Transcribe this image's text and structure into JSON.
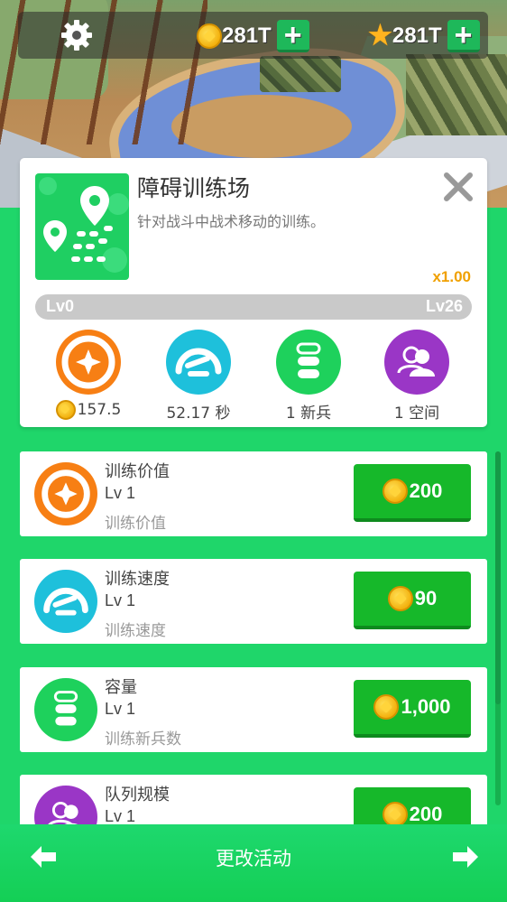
{
  "topbar": {
    "coins": "281T",
    "stars": "281T",
    "plus": "+"
  },
  "facility": {
    "title": "障碍训练场",
    "description": "针对战斗中战术移动的训练。",
    "multiplier": "x1.00",
    "level_start": "Lv0",
    "level_end": "Lv26",
    "level_progress": 0
  },
  "stats": [
    {
      "value": "157.5",
      "icon": "value-icon"
    },
    {
      "value": "52.17 秒",
      "icon": "speed-icon"
    },
    {
      "value": "1 新兵",
      "icon": "capacity-icon"
    },
    {
      "value": "1 空间",
      "icon": "queue-icon"
    }
  ],
  "upgrades": [
    {
      "name": "训练价值",
      "level": "Lv 1",
      "sub": "训练价值",
      "cost": "200",
      "color": "#f77f14"
    },
    {
      "name": "训练速度",
      "level": "Lv 1",
      "sub": "训练速度",
      "cost": "90",
      "color": "#1ec0db"
    },
    {
      "name": "容量",
      "level": "Lv 1",
      "sub": "训练新兵数",
      "cost": "1,000",
      "color": "#1ed15c"
    },
    {
      "name": "队列规模",
      "level": "Lv 1",
      "sub": "",
      "cost": "200",
      "color": "#9a36c6"
    }
  ],
  "bottombar": {
    "title": "更改活动"
  },
  "colors": {
    "accent_green": "#1fd66a",
    "buy_green": "#16b82a",
    "multiplier_orange": "#f0a000"
  }
}
